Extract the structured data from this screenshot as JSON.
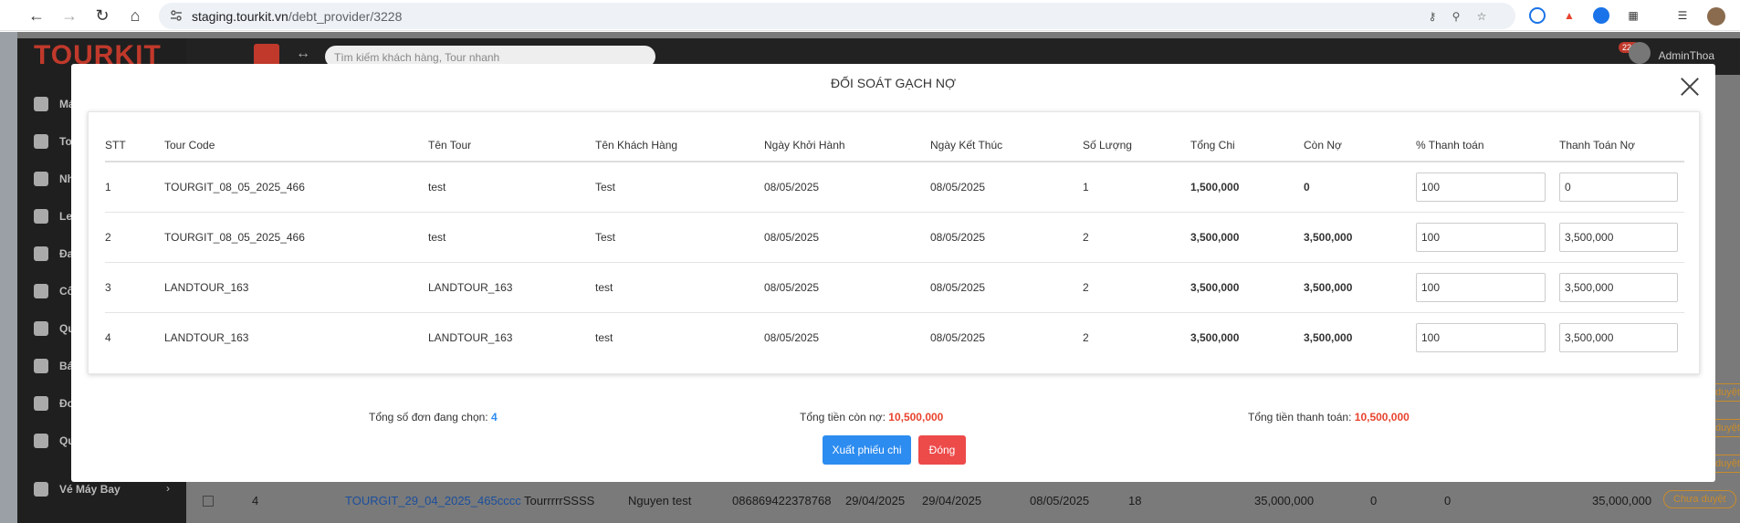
{
  "browser": {
    "url_host": "staging.tourkit.vn",
    "url_path": "/debt_provider/3228"
  },
  "app": {
    "logo": "TOURKIT",
    "search_placeholder": "Tìm kiếm khách hàng, Tour nhanh",
    "notification_count": "226",
    "user": "AdminThoa",
    "sidebar": [
      {
        "label": "Má"
      },
      {
        "label": "To"
      },
      {
        "label": "Nh"
      },
      {
        "label": "Le"
      },
      {
        "label": "Đa"
      },
      {
        "label": "Cô"
      },
      {
        "label": "Qu"
      },
      {
        "label": "Bá"
      },
      {
        "label": "Đơ"
      },
      {
        "label": "Qu"
      },
      {
        "label": "Vé Máy Bay"
      }
    ],
    "background_row": {
      "stt": "4",
      "code": "TOURGIT_29_04_2025_465cccc",
      "tour": "TourrrrrSSSS",
      "customer": "Nguyen test",
      "phone": "086869422378768",
      "date1": "29/04/2025",
      "date2": "29/04/2025",
      "date3": "08/05/2025",
      "qty": "18",
      "total": "35,000,000",
      "a": "0",
      "b": "0",
      "debt": "35,000,000",
      "status": "Chưa duyệt"
    },
    "side_badges": [
      "duyệt",
      "duyệt",
      "duyệt"
    ]
  },
  "modal": {
    "title": "ĐỐI SOÁT GẠCH NỢ",
    "columns": [
      "STT",
      "Tour Code",
      "Tên Tour",
      "Tên Khách Hàng",
      "Ngày Khởi Hành",
      "Ngày Kết Thúc",
      "Số Lượng",
      "Tổng Chi",
      "Còn Nợ",
      "% Thanh toán",
      "Thanh Toán Nợ"
    ],
    "rows": [
      {
        "stt": "1",
        "code": "TOURGIT_08_05_2025_466",
        "tour": "test",
        "customer": "Test",
        "start": "08/05/2025",
        "end": "08/05/2025",
        "qty": "1",
        "total": "1,500,000",
        "debt": "0",
        "percent": "100",
        "pay": "0"
      },
      {
        "stt": "2",
        "code": "TOURGIT_08_05_2025_466",
        "tour": "test",
        "customer": "Test",
        "start": "08/05/2025",
        "end": "08/05/2025",
        "qty": "2",
        "total": "3,500,000",
        "debt": "3,500,000",
        "percent": "100",
        "pay": "3,500,000"
      },
      {
        "stt": "3",
        "code": "LANDTOUR_163",
        "tour": "LANDTOUR_163",
        "customer": "test",
        "start": "08/05/2025",
        "end": "08/05/2025",
        "qty": "2",
        "total": "3,500,000",
        "debt": "3,500,000",
        "percent": "100",
        "pay": "3,500,000"
      },
      {
        "stt": "4",
        "code": "LANDTOUR_163",
        "tour": "LANDTOUR_163",
        "customer": "test",
        "start": "08/05/2025",
        "end": "08/05/2025",
        "qty": "2",
        "total": "3,500,000",
        "debt": "3,500,000",
        "percent": "100",
        "pay": "3,500,000"
      }
    ],
    "summary": {
      "count_label": "Tổng số đơn đang chọn:",
      "count_value": "4",
      "debt_label": "Tổng tiền còn nợ:",
      "debt_value": "10,500,000",
      "paid_label": "Tổng tiền thanh toán:",
      "paid_value": "10,500,000"
    },
    "buttons": {
      "export": "Xuất phiếu chi",
      "close": "Đóng"
    }
  },
  "colors": {
    "primary": "#2d8cf0",
    "danger": "#ed4a4a",
    "count_blue": "#2d8cf0",
    "money_red": "#e8432e"
  }
}
